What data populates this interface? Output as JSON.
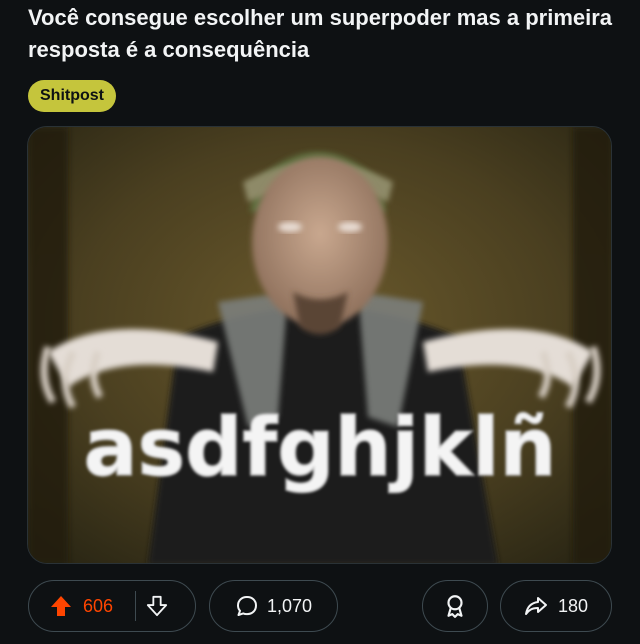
{
  "post": {
    "title": "Você consegue escolher um superpoder mas a primeira resposta é a consequência",
    "flair": "Shitpost",
    "image_caption_text": "asdfghjklñ"
  },
  "actions": {
    "upvotes": "606",
    "comments": "1,070",
    "shares": "180"
  },
  "colors": {
    "background": "#0e1113",
    "flair_bg": "#c5c53c",
    "upvote_active": "#ff4500",
    "pill_border": "#3e4a50"
  },
  "icons": {
    "upvote": "arrow-up-icon",
    "downvote": "arrow-down-icon",
    "comment": "speech-bubble-icon",
    "award": "award-ribbon-icon",
    "share": "share-arrow-icon"
  }
}
